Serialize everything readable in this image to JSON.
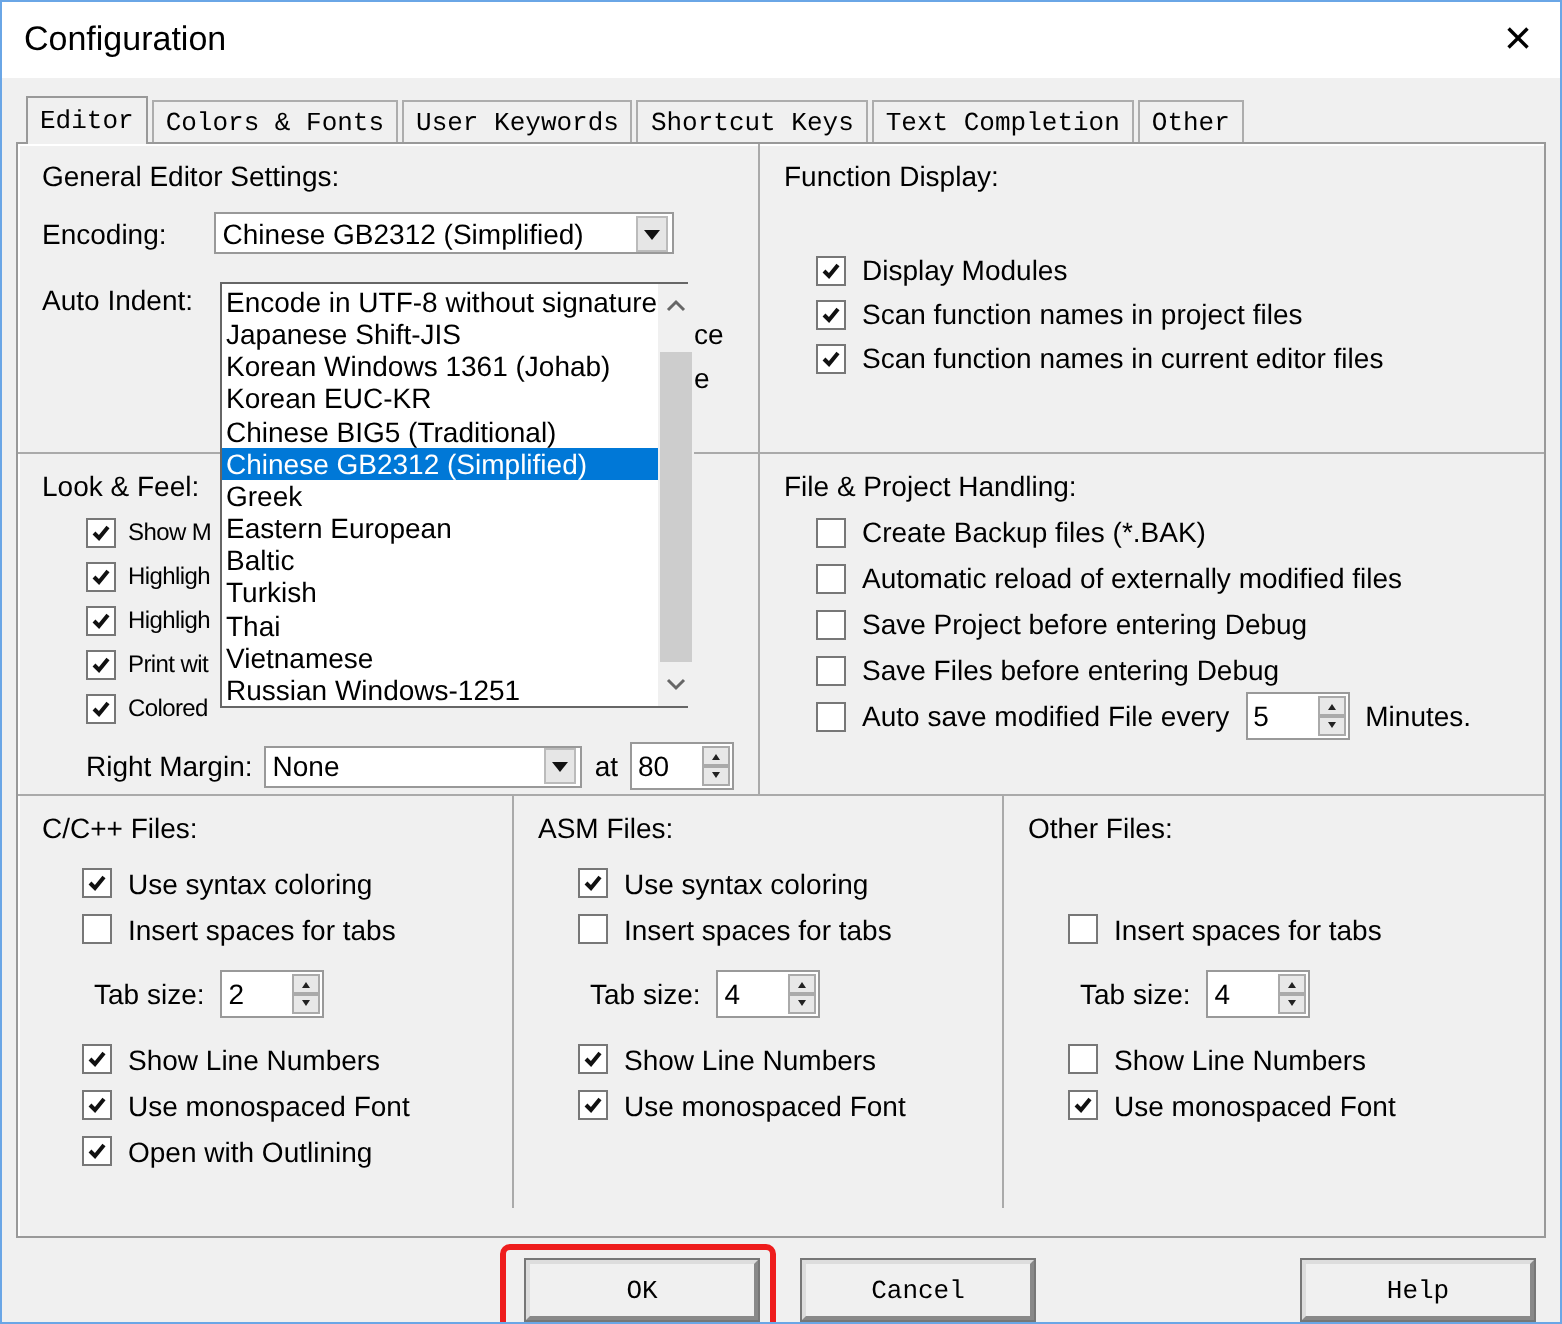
{
  "window": {
    "title": "Configuration",
    "close": "×"
  },
  "tabs": [
    {
      "label": "Editor",
      "selected": true
    },
    {
      "label": "Colors & Fonts",
      "selected": false
    },
    {
      "label": "User Keywords",
      "selected": false
    },
    {
      "label": "Shortcut Keys",
      "selected": false
    },
    {
      "label": "Text Completion",
      "selected": false
    },
    {
      "label": "Other",
      "selected": false
    }
  ],
  "general": {
    "title": "General Editor Settings:",
    "encoding_label": "Encoding:",
    "encoding_value": "Chinese GB2312 (Simplified)",
    "auto_indent_label": "Auto Indent:",
    "hidden_fragments": [
      "ce",
      "e"
    ],
    "encoding_list": [
      {
        "label": "Encode in UTF-8 without signature",
        "selected": false
      },
      {
        "label": "Japanese Shift-JIS",
        "selected": false
      },
      {
        "label": "Korean Windows 1361 (Johab)",
        "selected": false
      },
      {
        "label": "Korean EUC-KR",
        "selected": false
      },
      {
        "label": "Chinese BIG5 (Traditional)",
        "selected": false
      },
      {
        "label": "Chinese GB2312 (Simplified)",
        "selected": true
      },
      {
        "label": "Greek",
        "selected": false
      },
      {
        "label": "Eastern European",
        "selected": false
      },
      {
        "label": "Baltic",
        "selected": false
      },
      {
        "label": "Turkish",
        "selected": false
      },
      {
        "label": "Thai",
        "selected": false
      },
      {
        "label": "Vietnamese",
        "selected": false
      },
      {
        "label": "Russian Windows-1251",
        "selected": false
      }
    ]
  },
  "function_display": {
    "title": "Function Display:",
    "options": [
      {
        "label": "Display Modules",
        "checked": true
      },
      {
        "label": "Scan function names in project files",
        "checked": true
      },
      {
        "label": "Scan function names in current editor files",
        "checked": true
      }
    ]
  },
  "look_feel": {
    "title": "Look & Feel:",
    "options": [
      {
        "label": "Show M",
        "checked": true
      },
      {
        "label": "Highligh",
        "checked": true
      },
      {
        "label": "Highligh",
        "checked": true
      },
      {
        "label": "Print wit",
        "checked": true
      },
      {
        "label": "Colored",
        "checked": true
      }
    ],
    "right_margin_label": "Right Margin:",
    "right_margin_value": "None",
    "at_label": "at",
    "at_value": "80"
  },
  "file_handling": {
    "title": "File & Project Handling:",
    "options": [
      {
        "label": "Create Backup files (*.BAK)",
        "checked": false
      },
      {
        "label": "Automatic reload of externally modified files",
        "checked": false
      },
      {
        "label": "Save Project before entering Debug",
        "checked": false
      },
      {
        "label": "Save Files before entering Debug",
        "checked": false
      }
    ],
    "autosave": {
      "label": "Auto save modified File every",
      "checked": false,
      "value": "5",
      "unit": "Minutes."
    }
  },
  "file_types": [
    {
      "title": "C/C++ Files:",
      "syntax_coloring": {
        "label": "Use syntax coloring",
        "checked": true
      },
      "insert_spaces": {
        "label": "Insert spaces for tabs",
        "checked": false
      },
      "tab_size": {
        "label": "Tab size:",
        "value": "2"
      },
      "line_numbers": {
        "label": "Show Line Numbers",
        "checked": true
      },
      "monospaced": {
        "label": "Use monospaced Font",
        "checked": true
      },
      "outlining": {
        "label": "Open with Outlining",
        "checked": true
      }
    },
    {
      "title": "ASM Files:",
      "syntax_coloring": {
        "label": "Use syntax coloring",
        "checked": true
      },
      "insert_spaces": {
        "label": "Insert spaces for tabs",
        "checked": false
      },
      "tab_size": {
        "label": "Tab size:",
        "value": "4"
      },
      "line_numbers": {
        "label": "Show Line Numbers",
        "checked": true
      },
      "monospaced": {
        "label": "Use monospaced Font",
        "checked": true
      }
    },
    {
      "title": "Other Files:",
      "insert_spaces": {
        "label": "Insert spaces for tabs",
        "checked": false
      },
      "tab_size": {
        "label": "Tab size:",
        "value": "4"
      },
      "line_numbers": {
        "label": "Show Line Numbers",
        "checked": false
      },
      "monospaced": {
        "label": "Use monospaced Font",
        "checked": true
      }
    }
  ],
  "buttons": [
    {
      "label": "OK",
      "highlighted": true
    },
    {
      "label": "Cancel",
      "highlighted": false
    },
    {
      "label": "Help",
      "highlighted": false
    }
  ]
}
